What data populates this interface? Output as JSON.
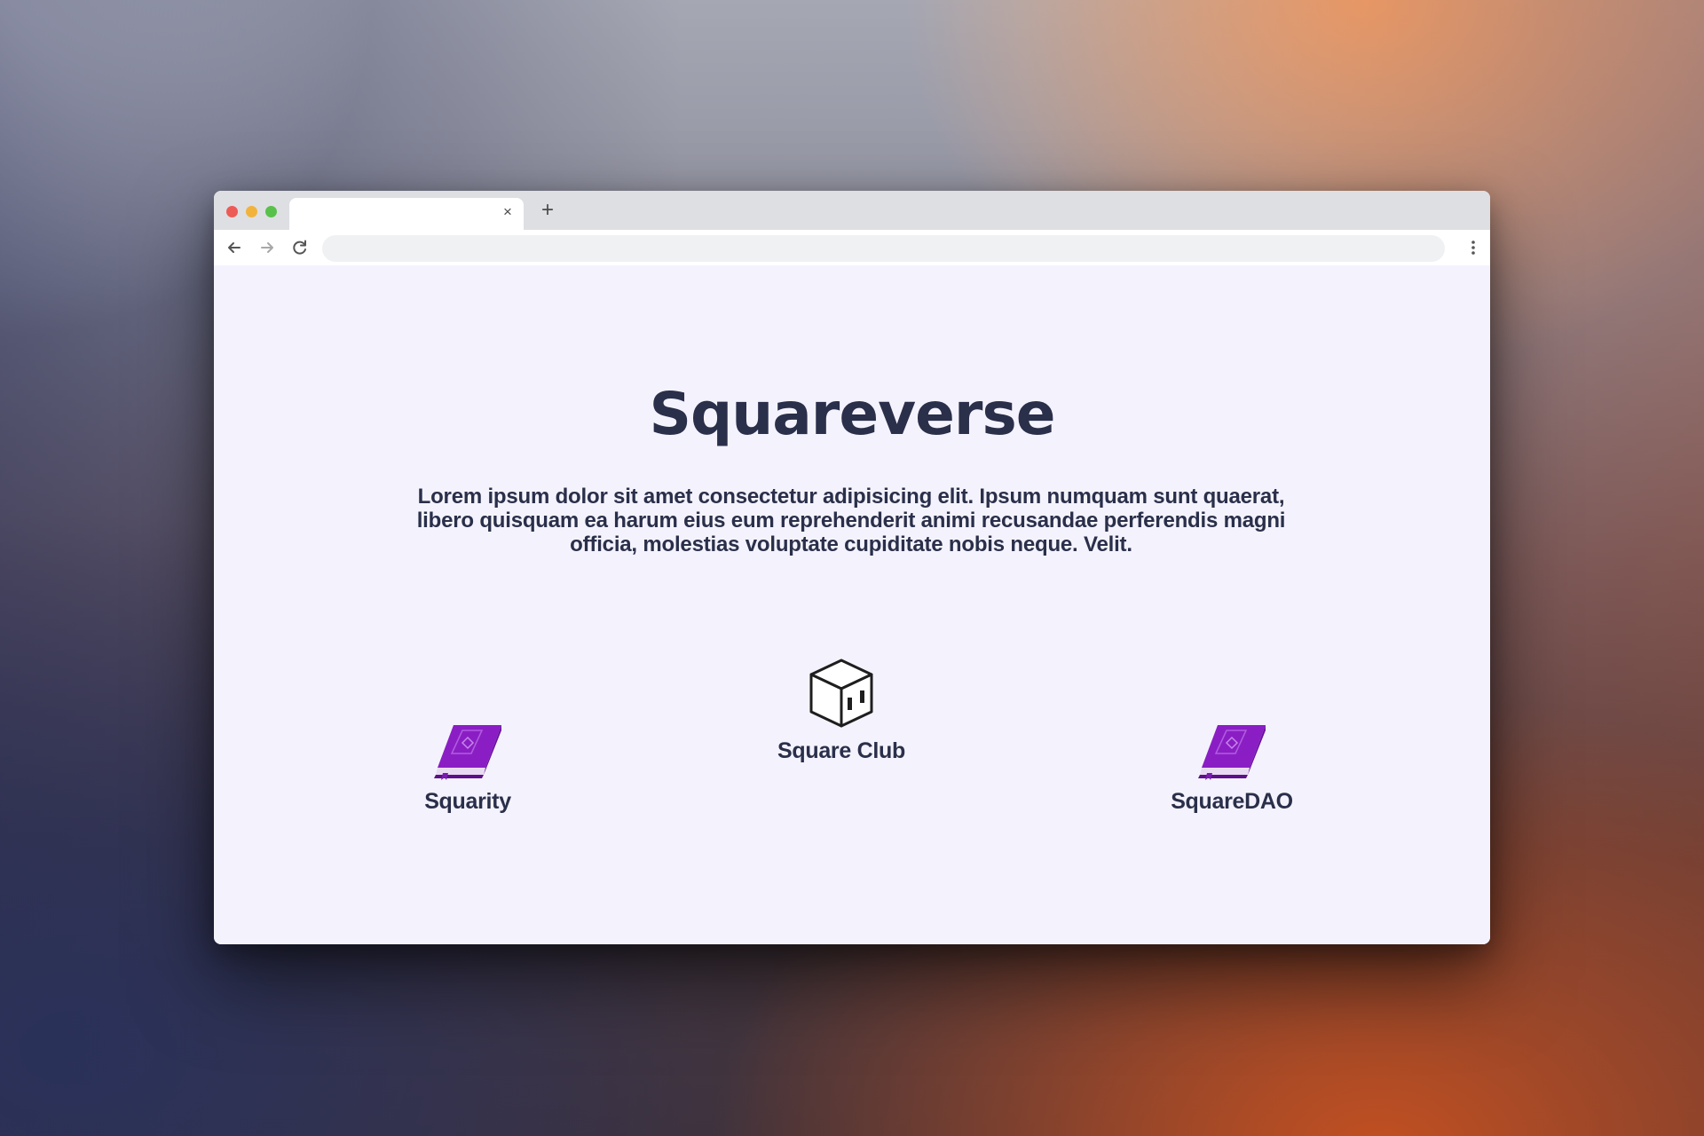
{
  "browser": {
    "tab_close_glyph": "×",
    "new_tab_glyph": "+",
    "address_value": "",
    "icons": {
      "back": "arrow-left-icon",
      "forward": "arrow-right-icon",
      "reload": "reload-icon",
      "menu": "kebab-menu-icon"
    },
    "traffic_colors": [
      "#ed5b56",
      "#f2b33c",
      "#58c14a"
    ]
  },
  "page": {
    "title": "Squareverse",
    "description": "Lorem ipsum dolor sit amet consectetur adipisicing elit. Ipsum numquam sunt quaerat, libero quisquam ea harum eius eum reprehenderit animi recusandae perferendis magni officia, molestias voluptate cupiditate nobis neque. Velit.",
    "text_color": "#2a2f4a",
    "background_color": "#f4f3fd",
    "projects": [
      {
        "label": "Squarity",
        "icon": "purple-book-icon"
      },
      {
        "label": "Square Club",
        "icon": "cube-box-icon"
      },
      {
        "label": "SquareDAO",
        "icon": "purple-book-icon"
      }
    ],
    "accent_color": "#8a1ec4"
  }
}
